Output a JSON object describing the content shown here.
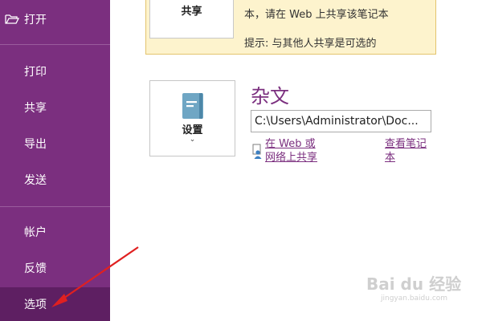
{
  "sidebar": {
    "open_label": "打开",
    "items": [
      {
        "label": "打印"
      },
      {
        "label": "共享"
      },
      {
        "label": "导出"
      },
      {
        "label": "发送"
      },
      {
        "label": "帐户"
      },
      {
        "label": "反馈"
      },
      {
        "label": "选项"
      }
    ],
    "selected": "选项",
    "background": "#7b2f7f",
    "selected_background": "#5e1f62"
  },
  "share_notice": {
    "button_label": "共享",
    "text": "本，请在 Web 上共享该笔记本",
    "tip": "提示: 与其他人共享是可选的"
  },
  "settings": {
    "label": "设置",
    "caret": "⌄",
    "icon": "notebook-icon"
  },
  "notebook": {
    "title": "杂文",
    "path": "C:\\Users\\Administrator\\Doc...",
    "share_link_line1": "在 Web 或",
    "share_link_line2": "网络上共享",
    "view_link_line1": "查看笔记",
    "view_link_line2": "本"
  },
  "annotation": {
    "color": "#e02020"
  },
  "watermark": {
    "logo": "Bai du 经验",
    "sub": "jingyan.baidu.com"
  }
}
